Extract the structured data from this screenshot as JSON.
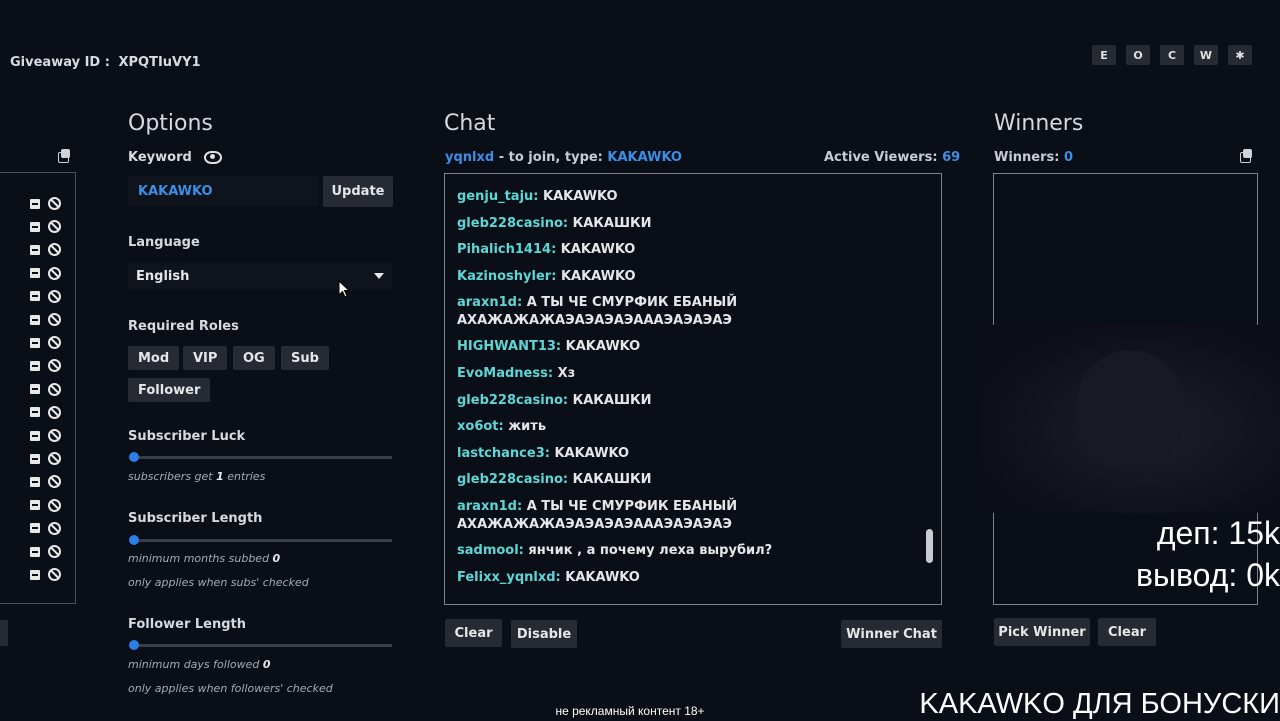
{
  "header": {
    "giveaway_id_label": "Giveaway ID :",
    "giveaway_id": "XPQTIuVY1",
    "top_buttons": [
      "E",
      "O",
      "C",
      "W",
      "✱"
    ]
  },
  "options": {
    "title": "Options",
    "keyword_label": "Keyword",
    "keyword_value": "KAKAWKO",
    "update_label": "Update",
    "language_label": "Language",
    "language_value": "English",
    "required_roles_label": "Required Roles",
    "roles": [
      "Mod",
      "VIP",
      "OG",
      "Sub",
      "Follower"
    ],
    "subscriber_luck": {
      "label": "Subscriber Luck",
      "hint_pre": "subscribers get",
      "value": "1",
      "hint_post": "entries",
      "level": 0
    },
    "subscriber_length": {
      "label": "Subscriber Length",
      "hint_pre": "minimum months subbed",
      "value": "0",
      "hint2": "only applies when subs' checked",
      "level": 0
    },
    "follower_length": {
      "label": "Follower Length",
      "hint_pre": "minimum days followed",
      "value": "0",
      "hint2": "only applies when followers' checked",
      "level": 0
    }
  },
  "chat": {
    "title": "Chat",
    "channel": "yqnlxd",
    "join_text": "- to join, type:",
    "keyword": "KAKAWKO",
    "active_viewers_label": "Active Viewers:",
    "active_viewers": "69",
    "messages": [
      {
        "user": "genju_taju:",
        "text": "KAKAWKO"
      },
      {
        "user": "gleb228casino:",
        "text": "КАКАШКИ"
      },
      {
        "user": "Pihalich1414:",
        "text": "KAKAWKO"
      },
      {
        "user": "Kazinoshyler:",
        "text": "KAKAWKO"
      },
      {
        "user": "araxn1d:",
        "text": "А ТЫ ЧЕ СМУРФИК ЕБАНЫЙ АХАЖАЖАЖАЭАЭАЭАЭАААЭАЭАЭАЭ"
      },
      {
        "user": "HIGHWANT13:",
        "text": "KAKAWKO"
      },
      {
        "user": "EvoMadness:",
        "text": "Хз"
      },
      {
        "user": "gleb228casino:",
        "text": "КАКАШКИ"
      },
      {
        "user": "xo6ot:",
        "text": "жить"
      },
      {
        "user": "lastchance3:",
        "text": "KAKAWKO"
      },
      {
        "user": "gleb228casino:",
        "text": "КАКАШКИ"
      },
      {
        "user": "araxn1d:",
        "text": "А ТЫ ЧЕ СМУРФИК ЕБАНЫЙ АХАЖАЖАЖАЭАЭАЭАЭАААЭАЭАЭАЭ"
      },
      {
        "user": "sadmool:",
        "text": "янчик , а почему леха вырубил?"
      },
      {
        "user": "Felixx_yqnlxd:",
        "text": "KAKAWKO"
      }
    ],
    "clear_label": "Clear",
    "disable_label": "Disable",
    "winner_chat_label": "Winner Chat"
  },
  "winners": {
    "title": "Winners",
    "count_label": "Winners:",
    "count": "0",
    "pick_label": "Pick Winner",
    "clear_label": "Clear"
  },
  "overlay": {
    "dep": "деп: 15k",
    "withdraw": "вывод: 0k",
    "note": "не рекламный контент 18+",
    "banner": "KAKAWKO ДЛЯ БОНУСКИ"
  }
}
